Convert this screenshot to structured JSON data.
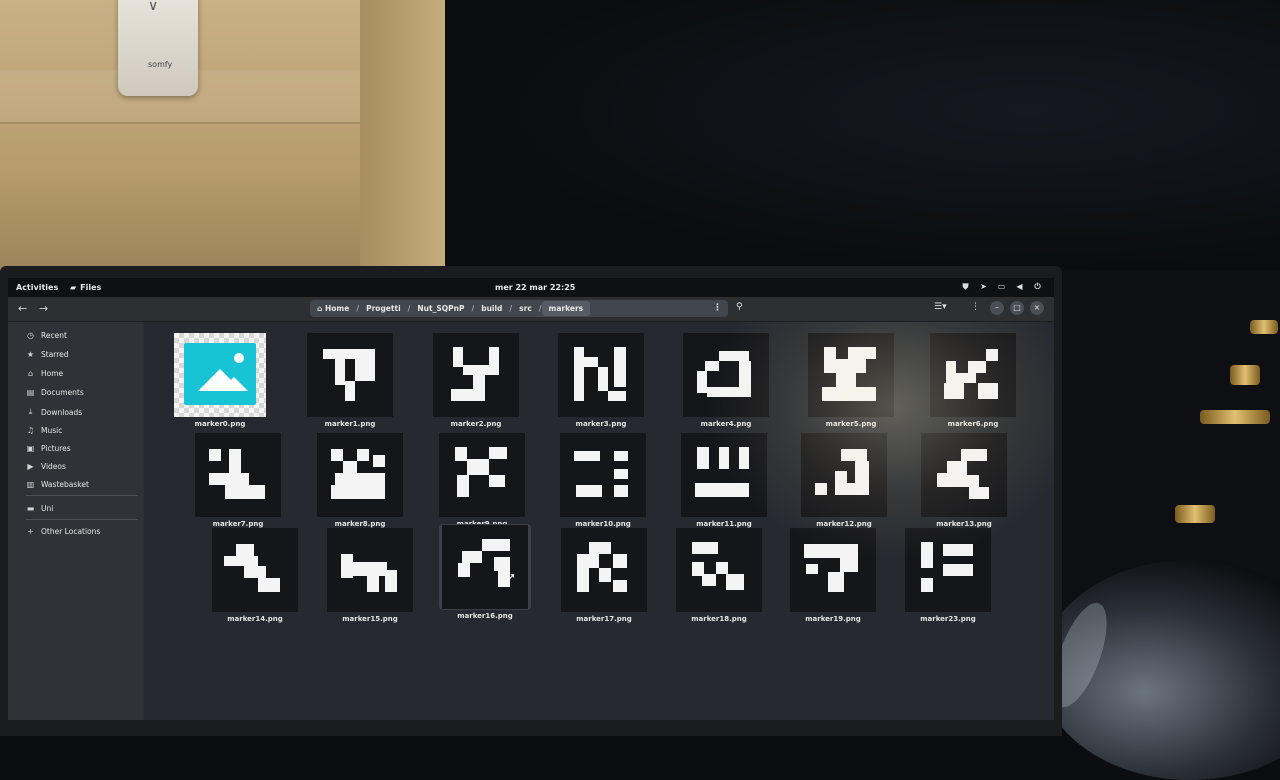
{
  "environment": {
    "remote_brand": "somfy"
  },
  "topbar": {
    "activities": "Activities",
    "app_name": "Files",
    "clock": "mer 22 mar  22:25",
    "tray_icons": [
      "shield-icon",
      "send-icon",
      "screen-icon",
      "volume-icon",
      "power-icon"
    ]
  },
  "headerbar": {
    "back_icon": "←",
    "forward_icon": "→",
    "path": [
      "Home",
      "Progetti",
      "Nut_SQPnP",
      "build",
      "src",
      "markers"
    ],
    "path_separator": "/",
    "path_menu_icon": "⋮",
    "search_icon": "search-icon",
    "view_icon": "list-view-icon",
    "menu_icon": "⋮",
    "minimize": "–",
    "maximize": "□",
    "close": "×"
  },
  "sidebar": {
    "items": [
      {
        "label": "Recent",
        "icon": "clock-icon"
      },
      {
        "label": "Starred",
        "icon": "star-icon"
      },
      {
        "label": "Home",
        "icon": "home-icon"
      },
      {
        "label": "Documents",
        "icon": "document-icon"
      },
      {
        "label": "Downloads",
        "icon": "download-icon"
      },
      {
        "label": "Music",
        "icon": "music-icon"
      },
      {
        "label": "Pictures",
        "icon": "picture-icon"
      },
      {
        "label": "Videos",
        "icon": "video-icon"
      },
      {
        "label": "Wastebasket",
        "icon": "trash-icon"
      },
      {
        "label": "Uni",
        "icon": "drive-icon"
      },
      {
        "label": "Other Locations",
        "icon": "plus-icon"
      }
    ]
  },
  "files": [
    {
      "name": "marker0.png"
    },
    {
      "name": "marker1.png"
    },
    {
      "name": "marker2.png"
    },
    {
      "name": "marker3.png"
    },
    {
      "name": "marker4.png"
    },
    {
      "name": "marker5.png"
    },
    {
      "name": "marker6.png"
    },
    {
      "name": "marker7.png"
    },
    {
      "name": "marker8.png"
    },
    {
      "name": "marker9.png"
    },
    {
      "name": "marker10.png"
    },
    {
      "name": "marker11.png"
    },
    {
      "name": "marker12.png"
    },
    {
      "name": "marker13.png"
    },
    {
      "name": "marker14.png"
    },
    {
      "name": "marker15.png"
    },
    {
      "name": "marker16.png"
    },
    {
      "name": "marker17.png"
    },
    {
      "name": "marker18.png"
    },
    {
      "name": "marker19.png"
    },
    {
      "name": "marker23.png"
    }
  ],
  "selected_file": "marker16.png",
  "colors": {
    "accent": "#19c3d6",
    "background": "#262a30",
    "sidebar": "#2f3338",
    "topbar": "#0f1012"
  }
}
